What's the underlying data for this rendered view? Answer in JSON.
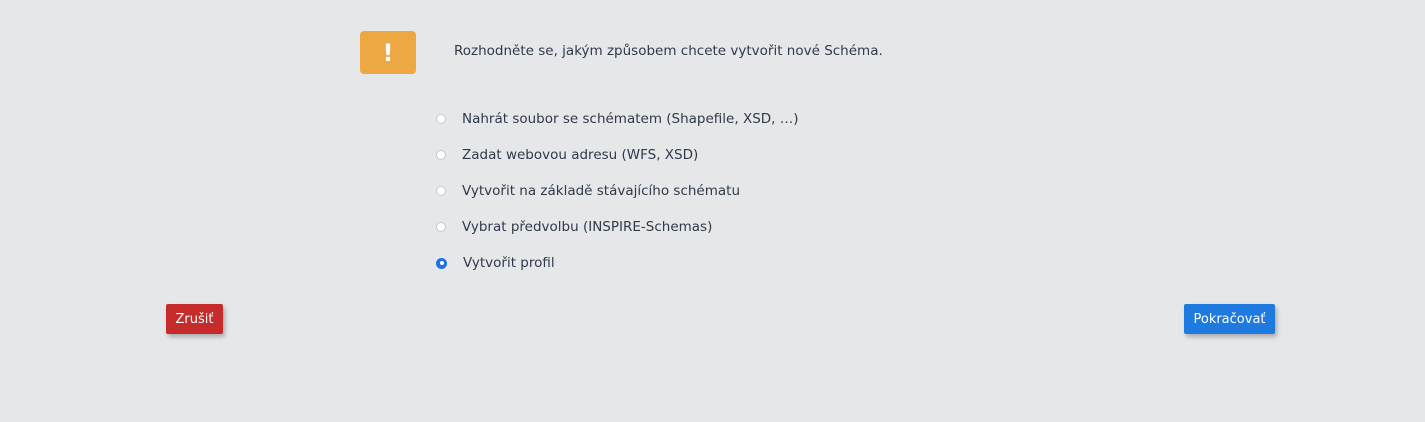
{
  "warning": {
    "icon": "exclamation-icon",
    "glyph": "!",
    "color": "#eea843"
  },
  "prompt": "Rozhodněte se, jakým způsobem chcete vytvořit nové Schéma.",
  "options": [
    {
      "label": "Nahrát soubor se schématem (Shapefile, XSD, …)",
      "selected": false
    },
    {
      "label": "Zadat webovou adresu (WFS, XSD)",
      "selected": false
    },
    {
      "label": "Vytvořit na základě stávajícího schématu",
      "selected": false
    },
    {
      "label": "Vybrat předvolbu (INSPIRE-Schemas)",
      "selected": false
    },
    {
      "label": "Vytvořit profil",
      "selected": true
    }
  ],
  "buttons": {
    "cancel_label": "Zrušiť",
    "continue_label": "Pokračovať",
    "cancel_color": "#c62b2b",
    "continue_color": "#1f7ae0"
  }
}
